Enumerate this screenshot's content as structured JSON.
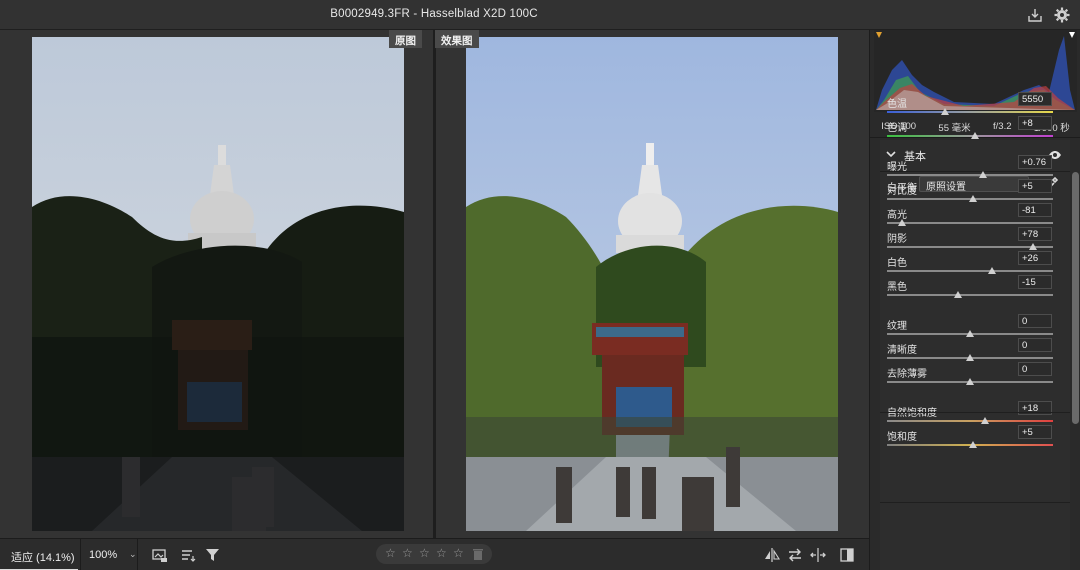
{
  "window": {
    "title": "B0002949.3FR -  Hasselblad X2D 100C"
  },
  "view": {
    "before_label": "原图",
    "after_label": "效果图"
  },
  "exif": {
    "iso": "ISO 100",
    "focal": "55 毫米",
    "aperture": "f/3.2",
    "shutter": "1/900 秒"
  },
  "basic": {
    "section_title": "基本",
    "wb_label": "白平衡",
    "wb_value": "原照设置",
    "sliders": [
      {
        "label": "色温",
        "value": "5550",
        "pos": 0.35
      },
      {
        "label": "色调",
        "value": "+8",
        "pos": 0.53
      },
      {
        "label": "曝光",
        "value": "+0.76",
        "pos": 0.58
      },
      {
        "label": "对比度",
        "value": "+5",
        "pos": 0.52
      },
      {
        "label": "高光",
        "value": "-81",
        "pos": 0.09
      },
      {
        "label": "阴影",
        "value": "+78",
        "pos": 0.88
      },
      {
        "label": "白色",
        "value": "+26",
        "pos": 0.63
      },
      {
        "label": "黑色",
        "value": "-15",
        "pos": 0.43
      },
      {
        "label": "纹理",
        "value": "0",
        "pos": 0.5
      },
      {
        "label": "清晰度",
        "value": "0",
        "pos": 0.5
      },
      {
        "label": "去除薄雾",
        "value": "0",
        "pos": 0.5
      },
      {
        "label": "自然饱和度",
        "value": "+18",
        "pos": 0.59
      },
      {
        "label": "饱和度",
        "value": "+5",
        "pos": 0.52
      }
    ]
  },
  "bottom": {
    "fit_label": "适应 (14.1%)",
    "zoom_label": "100%"
  }
}
